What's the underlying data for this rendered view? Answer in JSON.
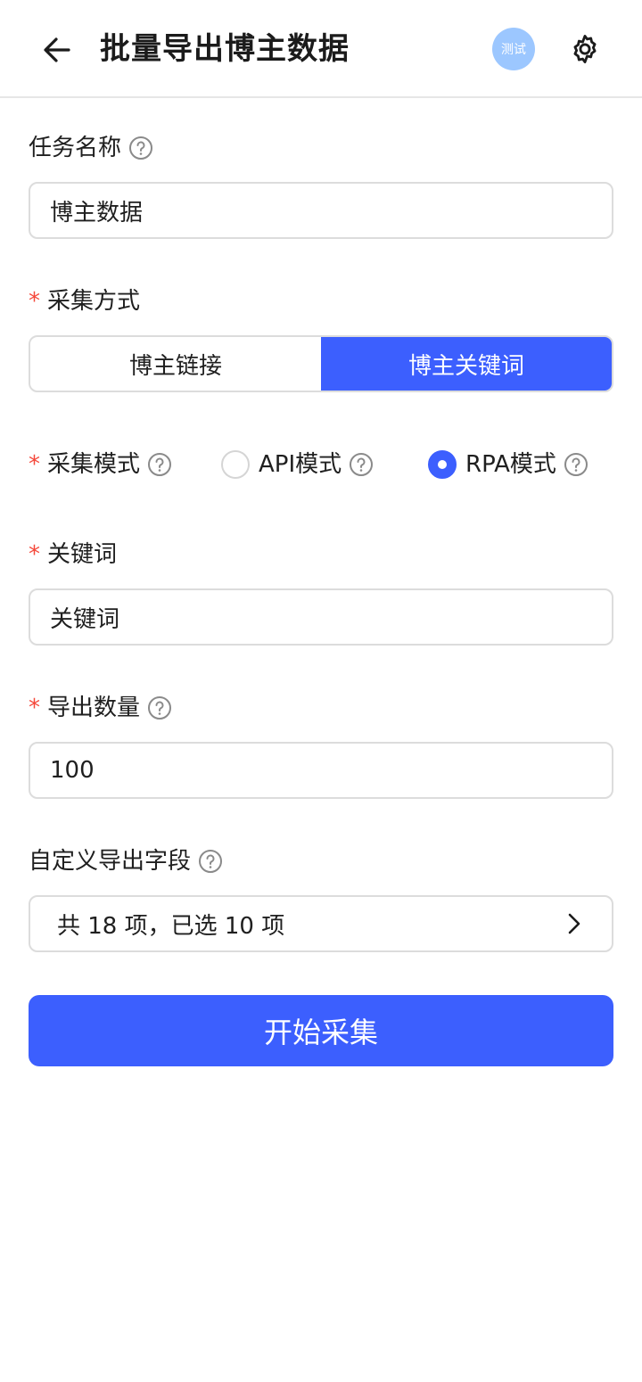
{
  "header": {
    "title": "批量导出博主数据",
    "badge": "测试",
    "icons": {
      "back": "arrow-left-icon",
      "settings": "gear-icon"
    }
  },
  "task_name": {
    "label": "任务名称",
    "value": "博主数据"
  },
  "collect_method": {
    "label": "采集方式",
    "required": true,
    "options": [
      "博主链接",
      "博主关键词"
    ],
    "selected": "博主关键词"
  },
  "collect_mode": {
    "label": "采集模式",
    "required": true,
    "options": [
      "API模式",
      "RPA模式"
    ],
    "selected": "RPA模式"
  },
  "keyword": {
    "label": "关键词",
    "required": true,
    "value": "关键词"
  },
  "export_count": {
    "label": "导出数量",
    "required": true,
    "value": "100"
  },
  "custom_fields": {
    "label": "自定义导出字段",
    "summary": "共 18 项，已选 10 项"
  },
  "submit_label": "开始采集",
  "colors": {
    "primary": "#3c5ffe",
    "required": "#f5483b",
    "badge": "#9cc7ff",
    "border": "#dcdcdc"
  }
}
